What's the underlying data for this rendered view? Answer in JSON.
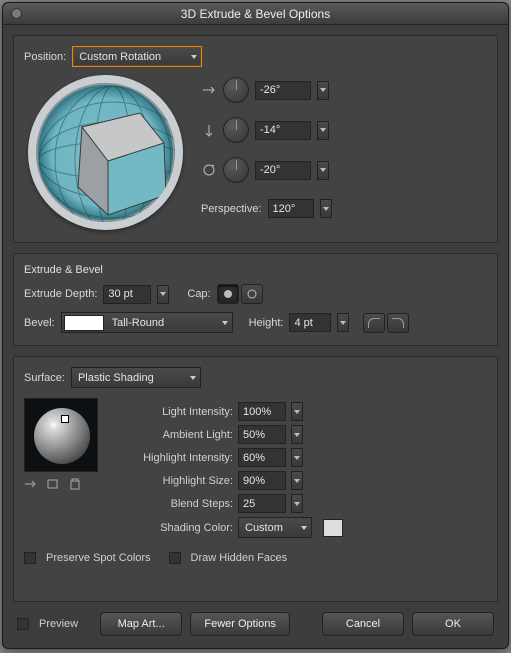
{
  "title": "3D Extrude & Bevel Options",
  "position": {
    "label": "Position:",
    "preset": "Custom Rotation",
    "x_rot": "-26°",
    "y_rot": "-14°",
    "z_rot": "-20°",
    "perspective_label": "Perspective:",
    "perspective": "120°"
  },
  "extrude": {
    "section": "Extrude & Bevel",
    "depth_label": "Extrude Depth:",
    "depth": "30 pt",
    "cap_label": "Cap:",
    "bevel_label": "Bevel:",
    "bevel_name": "Tall-Round",
    "height_label": "Height:",
    "height": "4 pt"
  },
  "surface": {
    "label": "Surface:",
    "shading": "Plastic Shading",
    "light_intensity_label": "Light Intensity:",
    "light_intensity": "100%",
    "ambient_label": "Ambient Light:",
    "ambient": "50%",
    "hi_intensity_label": "Highlight Intensity:",
    "hi_intensity": "60%",
    "hi_size_label": "Highlight Size:",
    "hi_size": "90%",
    "blend_label": "Blend Steps:",
    "blend": "25",
    "shade_color_label": "Shading Color:",
    "shade_color": "Custom",
    "preserve_spot": "Preserve Spot Colors",
    "hidden_faces": "Draw Hidden Faces"
  },
  "footer": {
    "preview": "Preview",
    "map_art": "Map Art...",
    "fewer": "Fewer Options",
    "cancel": "Cancel",
    "ok": "OK"
  }
}
